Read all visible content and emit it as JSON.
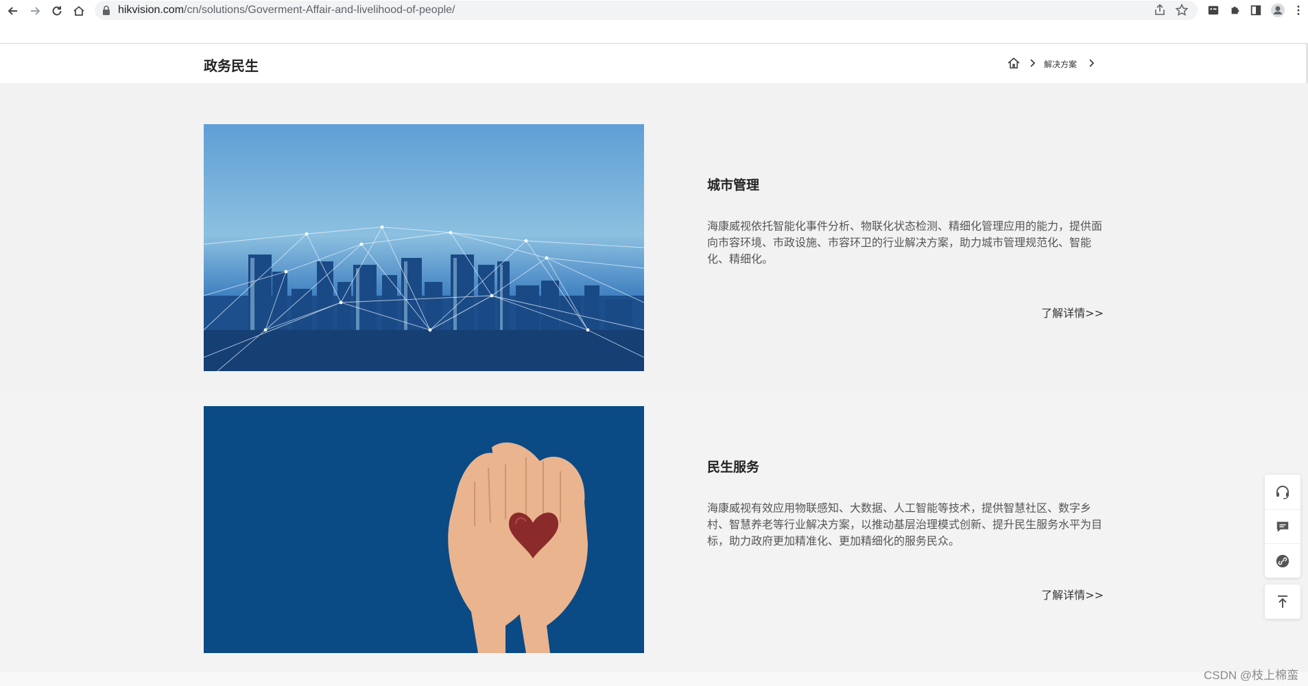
{
  "browser": {
    "url_host": "hikvision.com",
    "url_path": "/cn/solutions/Goverment-Affair-and-livelihood-of-people/"
  },
  "header": {
    "title": "政务民生",
    "breadcrumb": [
      "解决方案"
    ]
  },
  "solutions": [
    {
      "title": "城市管理",
      "description": "海康威视依托智能化事件分析、物联化状态检测、精细化管理应用的能力，提供面向市容环境、市政设施、市容环卫的行业解决方案，助力城市管理规范化、智能化、精细化。",
      "more_label": "了解详情>>",
      "image": "city-skyline-network"
    },
    {
      "title": "民生服务",
      "description": "海康威视有效应用物联感知、大数据、人工智能等技术，提供智慧社区、数字乡村、智慧养老等行业解决方案，以推动基层治理模式创新、提升民生服务水平为目标，助力政府更加精准化、更加精细化的服务民众。",
      "more_label": "了解详情>>",
      "image": "hands-holding-heart"
    }
  ],
  "float_bar": [
    "headset-icon",
    "message-icon",
    "link-icon",
    "back-to-top-icon"
  ],
  "watermark": "CSDN @枝上棉蛮",
  "colors": {
    "image_blue": "#0a4a85",
    "sky_blue": "#7fb4db",
    "heart_red": "#8a2a2a"
  }
}
